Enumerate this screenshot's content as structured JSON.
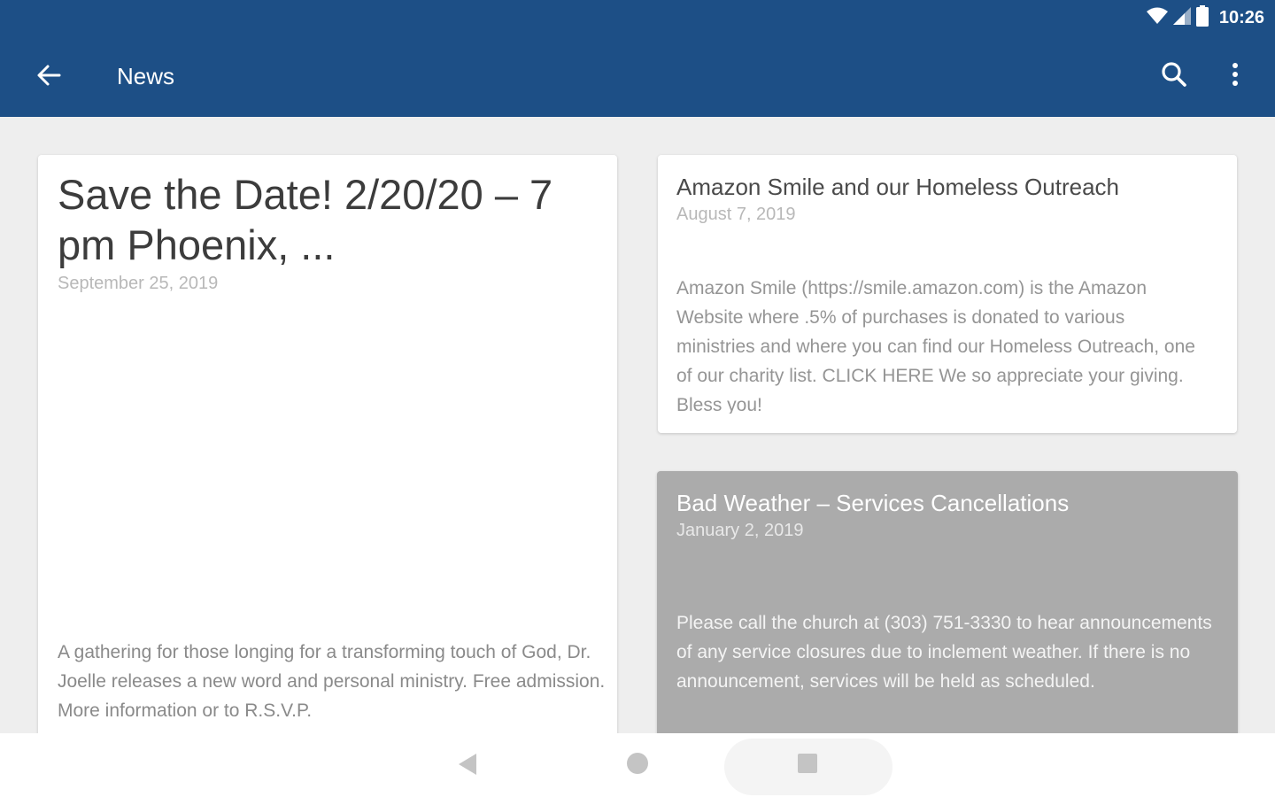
{
  "status_bar": {
    "time": "10:26",
    "icons": [
      "wifi-icon",
      "signal-icon",
      "battery-icon"
    ]
  },
  "app_bar": {
    "title": "News",
    "background_color": "#1d4f86",
    "icons": [
      "back-arrow-icon",
      "search-icon",
      "more-vert-icon"
    ]
  },
  "news": [
    {
      "title": "Save the Date! 2/20/20 – 7 pm Phoenix, ...",
      "date": "September 25, 2019",
      "excerpt": "A gathering for those longing for a transforming touch of God, Dr. Joelle releases a new word and personal ministry. Free admission. More information or to R.S.V.P."
    },
    {
      "title": "Amazon Smile and our Homeless Outreach",
      "date": "August 7, 2019",
      "excerpt": "Amazon Smile (https://smile.amazon.com) is the Amazon Website where .5% of purchases is donated to various ministries and where you can find our Homeless Outreach, one of our charity list. CLICK HERE We so appreciate your giving. Bless you!"
    },
    {
      "title": "Bad Weather – Services Cancellations",
      "date": "January 2, 2019",
      "excerpt": "Please call the church at (303) 751-3330 to hear announcements of any service closures due to inclement weather. If there is no announcement, services will be held as scheduled."
    }
  ],
  "nav_bar": {
    "icons": [
      "nav-back-icon",
      "nav-home-icon",
      "nav-recents-icon"
    ]
  }
}
